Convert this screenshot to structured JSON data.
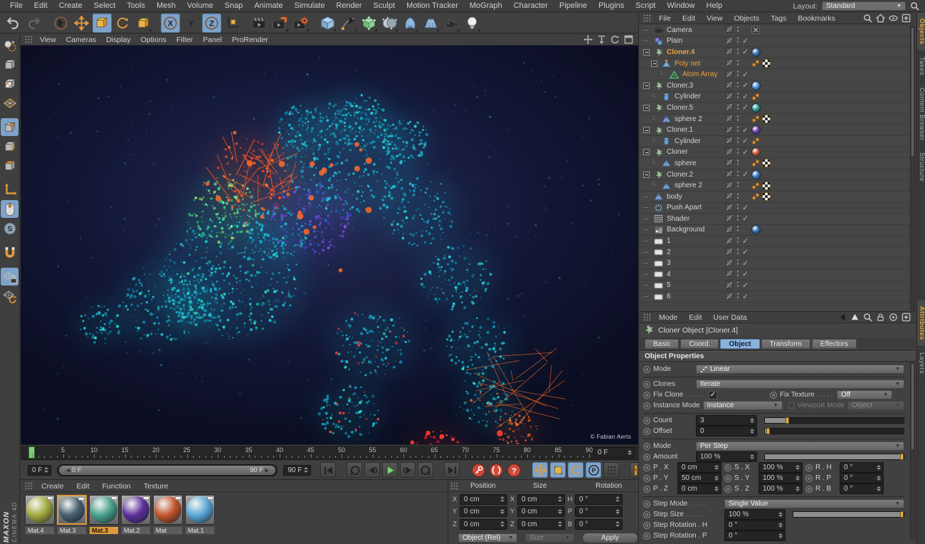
{
  "menubar": {
    "items": [
      "File",
      "Edit",
      "Create",
      "Select",
      "Tools",
      "Mesh",
      "Volume",
      "Snap",
      "Animate",
      "Simulate",
      "Render",
      "Sculpt",
      "Motion Tracker",
      "MoGraph",
      "Character",
      "Pipeline",
      "Plugins",
      "Script",
      "Window",
      "Help"
    ],
    "layout_label": "Layout:",
    "layout_value": "Standard"
  },
  "toolbar": {
    "icons": [
      {
        "name": "undo-button",
        "type": "undo"
      },
      {
        "name": "redo-button",
        "type": "redo"
      },
      {
        "type": "sep"
      },
      {
        "name": "select-tool-button",
        "type": "cursor"
      },
      {
        "name": "move-tool-button",
        "type": "move"
      },
      {
        "name": "scale-tool-button",
        "type": "scale",
        "active": true
      },
      {
        "name": "rotate-tool-button",
        "type": "rotate"
      },
      {
        "name": "last-used-tool-button",
        "type": "lasttool",
        "fly": true
      },
      {
        "type": "sep"
      },
      {
        "name": "lock-x-axis-button",
        "type": "axisx",
        "active": true
      },
      {
        "name": "lock-y-axis-button",
        "type": "axisy"
      },
      {
        "name": "lock-z-axis-button",
        "type": "axisz",
        "active": true
      },
      {
        "name": "coordinate-system-button",
        "type": "axes"
      },
      {
        "type": "sep"
      },
      {
        "name": "render-view-button",
        "type": "clap"
      },
      {
        "name": "render-to-picture-viewer-button",
        "type": "clap2",
        "fly": true
      },
      {
        "name": "render-settings-button",
        "type": "clap3",
        "fly": true
      },
      {
        "type": "sep"
      },
      {
        "name": "add-cube-primitive-button",
        "type": "cubeblue",
        "fly": true
      },
      {
        "name": "spline-pen-button",
        "type": "pen",
        "fly": true
      },
      {
        "name": "generators-button",
        "type": "cubegreen",
        "fly": true
      },
      {
        "name": "modeling-objects-button",
        "type": "spheres",
        "fly": true
      },
      {
        "name": "deformers-button",
        "type": "deformer",
        "fly": true
      },
      {
        "name": "environment-floor-button",
        "type": "floor",
        "fly": true
      },
      {
        "name": "camera-object-button",
        "type": "camtool",
        "fly": true
      },
      {
        "name": "light-object-button",
        "type": "bulb",
        "fly": true
      }
    ]
  },
  "left_toolbar": {
    "icons": [
      {
        "name": "make-editable-button",
        "type": "convert"
      },
      {
        "name": "model-mode-button",
        "type": "modelmode"
      },
      {
        "name": "texture-mode-button",
        "type": "texmode"
      },
      {
        "name": "workplane-mode-button",
        "type": "workplane"
      },
      {
        "type": "sep"
      },
      {
        "name": "points-mode-button",
        "type": "pointsmode",
        "active": true
      },
      {
        "name": "edges-mode-button",
        "type": "edgesmode"
      },
      {
        "name": "polygons-mode-button",
        "type": "polysmode"
      },
      {
        "type": "sep"
      },
      {
        "name": "enable-axis-button",
        "type": "axisL"
      },
      {
        "name": "viewport-tweak-button",
        "type": "mouse",
        "active": true
      },
      {
        "name": "snap-settings-button",
        "type": "snapS"
      },
      {
        "type": "sep"
      },
      {
        "name": "magnet-snap-button",
        "type": "magnet"
      },
      {
        "type": "sep"
      },
      {
        "name": "lock-workplane-button",
        "type": "wplock",
        "active": true
      },
      {
        "name": "workplane-rotate-button",
        "type": "wprot"
      }
    ]
  },
  "viewport": {
    "menu": [
      "View",
      "Cameras",
      "Display",
      "Options",
      "Filter",
      "Panel",
      "ProRender"
    ],
    "credit": "© Fabian Aerts",
    "nav_icons": [
      {
        "name": "viewport-pan-icon",
        "type": "vpan"
      },
      {
        "name": "viewport-zoom-icon",
        "type": "vzoom"
      },
      {
        "name": "viewport-rotate-icon",
        "type": "vrot"
      },
      {
        "name": "viewport-maximize-icon",
        "type": "vmax"
      }
    ]
  },
  "object_manager": {
    "menu": [
      "File",
      "Edit",
      "View",
      "Objects",
      "Tags",
      "Bookmarks"
    ],
    "icons": [
      {
        "name": "om-search-icon",
        "type": "search"
      },
      {
        "name": "om-home-icon",
        "type": "home"
      },
      {
        "name": "om-filter-icon",
        "type": "filter"
      },
      {
        "name": "om-add-panel-icon",
        "type": "addpanel"
      }
    ],
    "side_tabs": [
      {
        "label": "Objects",
        "active": true
      },
      {
        "label": "Takes",
        "active": false
      },
      {
        "label": "Content Browser",
        "active": false
      },
      {
        "label": "Structure",
        "active": false
      }
    ],
    "tree": [
      {
        "label": "Camera",
        "icon": "tcamera",
        "level": 0,
        "tags": [
          "target"
        ]
      },
      {
        "label": "Plain",
        "icon": "tplain",
        "level": 0,
        "check": true
      },
      {
        "label": "Cloner.4",
        "icon": "tcloner",
        "level": 0,
        "exp": true,
        "sel": true,
        "bold": true,
        "check": true,
        "mat": "#3a6fae"
      },
      {
        "label": "Poly net",
        "icon": "tpolynet",
        "level": 1,
        "exp": true,
        "sel": true,
        "tags": [
          "dots",
          "checker"
        ]
      },
      {
        "label": "Atom Array",
        "icon": "tatom",
        "level": 2,
        "sel": true,
        "check": true
      },
      {
        "label": "Cloner.3",
        "icon": "tcloner",
        "level": 0,
        "exp": true,
        "check": true,
        "mat": "#4a90d9"
      },
      {
        "label": "Cylinder",
        "icon": "tcylinder",
        "level": 1,
        "check": true,
        "tags": [
          "dots"
        ]
      },
      {
        "label": "Cloner.5",
        "icon": "tcloner",
        "level": 0,
        "exp": true,
        "check": true,
        "mat": "#2f9e93"
      },
      {
        "label": "sphere 2",
        "icon": "tpyr",
        "level": 1,
        "tags": [
          "dots",
          "checker"
        ]
      },
      {
        "label": "Cloner.1",
        "icon": "tcloner",
        "level": 0,
        "exp": true,
        "check": true,
        "mat": "#6d3fa8"
      },
      {
        "label": "Cylinder",
        "icon": "tcylinder",
        "level": 1,
        "check": true,
        "tags": [
          "dots"
        ]
      },
      {
        "label": "Cloner",
        "icon": "tcloner",
        "level": 0,
        "exp": true,
        "check": true,
        "mat": "#c5542c"
      },
      {
        "label": "sphere",
        "icon": "tpyr",
        "level": 1,
        "tags": [
          "dots",
          "checker"
        ]
      },
      {
        "label": "Cloner.2",
        "icon": "tcloner",
        "level": 0,
        "exp": true,
        "check": true,
        "mat": "#3f7fc4"
      },
      {
        "label": "sphere 2",
        "icon": "tpyr",
        "level": 1,
        "tags": [
          "dots",
          "checker"
        ]
      },
      {
        "label": "body",
        "icon": "tpyr",
        "level": 0,
        "tags": [
          "dots",
          "checker"
        ]
      },
      {
        "label": "Push Apart",
        "icon": "tpush",
        "level": 0,
        "check": true
      },
      {
        "label": "Shader",
        "icon": "tshader",
        "level": 0,
        "check": true
      },
      {
        "label": "Background",
        "icon": "tbg",
        "level": 0,
        "mat": "#3a6fae"
      },
      {
        "label": "1",
        "icon": "tnull",
        "level": 0,
        "check": true
      },
      {
        "label": "2",
        "icon": "tnull",
        "level": 0,
        "check": true
      },
      {
        "label": "3",
        "icon": "tnull",
        "level": 0,
        "check": true
      },
      {
        "label": "4",
        "icon": "tnull",
        "level": 0,
        "check": true
      },
      {
        "label": "5",
        "icon": "tnull",
        "level": 0,
        "check": true
      },
      {
        "label": "6",
        "icon": "tnull",
        "level": 0,
        "check": true
      }
    ]
  },
  "attribute_manager": {
    "menu": [
      "Mode",
      "Edit",
      "User Data"
    ],
    "icons": [
      {
        "name": "am-back-icon",
        "type": "amback"
      },
      {
        "name": "am-arrow-icon",
        "type": "amup"
      },
      {
        "name": "am-search-icon",
        "type": "search"
      },
      {
        "name": "am-lock-icon",
        "type": "amlock"
      },
      {
        "name": "am-history-icon",
        "type": "amhist"
      },
      {
        "name": "am-add-panel-icon",
        "type": "addpanel"
      }
    ],
    "title": "Cloner Object [Cloner.4]",
    "tabs": [
      {
        "label": "Basic",
        "active": false
      },
      {
        "label": "Coord.",
        "active": false
      },
      {
        "label": "Object",
        "active": true
      },
      {
        "label": "Transform",
        "active": false
      },
      {
        "label": "Effectors",
        "active": false
      }
    ],
    "section": "Object Properties",
    "side_tabs": [
      {
        "label": "Attributes",
        "active": true
      },
      {
        "label": "Layers",
        "active": false
      }
    ],
    "props": {
      "mode": {
        "label": "Mode",
        "value": "Linear"
      },
      "clones": {
        "label": "Clones",
        "value": "Iterate"
      },
      "fix_clone": {
        "label": "Fix Clone",
        "checked": true
      },
      "fix_texture": {
        "label": "Fix Texture",
        "value": "Off"
      },
      "instance_mode": {
        "label": "Instance Mode",
        "value": "Instance"
      },
      "viewport_mode": {
        "label": "Viewport Mode",
        "value": "Object"
      },
      "count": {
        "label": "Count",
        "value": "3"
      },
      "offset": {
        "label": "Offset",
        "value": "0"
      },
      "step_mode_top": {
        "label": "Mode",
        "value": "Per Step"
      },
      "amount": {
        "label": "Amount",
        "value": "100 %"
      },
      "transform_rows": [
        {
          "p_label": "P . X",
          "p_value": "0 cm",
          "s_label": "S . X",
          "s_value": "100 %",
          "r_label": "R . H",
          "r_value": "0 °"
        },
        {
          "p_label": "P . Y",
          "p_value": "50 cm",
          "s_label": "S . Y",
          "s_value": "100 %",
          "r_label": "R . P",
          "r_value": "0 °"
        },
        {
          "p_label": "P . Z",
          "p_value": "0 cm",
          "s_label": "S . Z",
          "s_value": "100 %",
          "r_label": "R . B",
          "r_value": "0 °"
        }
      ],
      "step_mode": {
        "label": "Step Mode",
        "value": "Single Value"
      },
      "step_size": {
        "label": "Step Size",
        "value": "100 %"
      },
      "step_rotation_h": {
        "label": "Step Rotation . H",
        "value": "0 °"
      },
      "step_rotation_p": {
        "label": "Step Rotation . P",
        "value": "0 °"
      }
    }
  },
  "timeline": {
    "start": 0,
    "end": 90,
    "label_step": 5,
    "current_frame": "0 F",
    "ruler_field": "0 F",
    "range_start": "0 F",
    "range_end": "90 F",
    "end_frame": "90 F"
  },
  "transport": {
    "buttons": [
      {
        "name": "goto-start-button",
        "type": "gstart"
      },
      {
        "name": "previous-key-button",
        "type": "pkey",
        "gap": true
      },
      {
        "name": "previous-frame-button",
        "type": "pframe"
      },
      {
        "name": "play-button",
        "type": "play"
      },
      {
        "name": "next-frame-button",
        "type": "nframe"
      },
      {
        "name": "next-key-button",
        "type": "nkey"
      },
      {
        "name": "goto-end-button",
        "type": "gend",
        "gap": true
      },
      {
        "name": "record-keyframe-button",
        "type": "reckey",
        "round": true,
        "gap": true
      },
      {
        "name": "record-selection-button",
        "type": "recsel",
        "round": true
      },
      {
        "name": "autokeying-button",
        "type": "rechelp",
        "round": true
      },
      {
        "name": "keyframe-position-toggle",
        "type": "kpos",
        "active": true,
        "gap": true
      },
      {
        "name": "keyframe-scale-toggle",
        "type": "kscale",
        "active": true
      },
      {
        "name": "keyframe-rotation-toggle",
        "type": "krot",
        "active": true
      },
      {
        "name": "keyframe-parameter-toggle",
        "type": "kparam",
        "active": true
      },
      {
        "name": "keyframe-pla-toggle",
        "type": "kpla"
      },
      {
        "name": "keyframe-selection-button",
        "type": "ksel",
        "gap": true
      }
    ]
  },
  "materials": {
    "menu": [
      "Create",
      "Edit",
      "Function",
      "Texture"
    ],
    "items": [
      {
        "label": "Mat.4",
        "color": "#a3a93f",
        "thumb_selected": false,
        "label_selected": false
      },
      {
        "label": "Mat.3",
        "color": "#46606e",
        "thumb_selected": true,
        "label_selected": false
      },
      {
        "label": "Mat.3",
        "color": "#49a08b",
        "thumb_selected": false,
        "label_selected": true
      },
      {
        "label": "Mat.2",
        "color": "#5c2f9b",
        "thumb_selected": false,
        "label_selected": false
      },
      {
        "label": "Mat",
        "color": "#c25329",
        "thumb_selected": false,
        "label_selected": false
      },
      {
        "label": "Mat.1",
        "color": "#5aa7d6",
        "thumb_selected": false,
        "label_selected": false
      }
    ]
  },
  "coordinates": {
    "headers": [
      "Position",
      "Size",
      "Rotation"
    ],
    "rows": [
      {
        "p_label": "X",
        "p_value": "0 cm",
        "s_label": "X",
        "s_value": "0 cm",
        "r_label": "H",
        "r_value": "0 °"
      },
      {
        "p_label": "Y",
        "p_value": "0 cm",
        "s_label": "Y",
        "s_value": "0 cm",
        "r_label": "P",
        "r_value": "0 °"
      },
      {
        "p_label": "Z",
        "p_value": "0 cm",
        "s_label": "Z",
        "s_value": "0 cm",
        "r_label": "B",
        "r_value": "0 °"
      }
    ],
    "object_mode": "Object (Rel)",
    "size_mode": "Size",
    "apply_label": "Apply"
  },
  "branding": {
    "line1": "MAXON",
    "line2": "CINEMA 4D"
  },
  "colors": {
    "accent_orange": "#e09a3f",
    "selection_blue": "#8cb3de",
    "check_green": "#8fd48f",
    "record_red": "#cf4a3c",
    "play_green": "#7ed87e",
    "viewport_bg": "#131736"
  }
}
